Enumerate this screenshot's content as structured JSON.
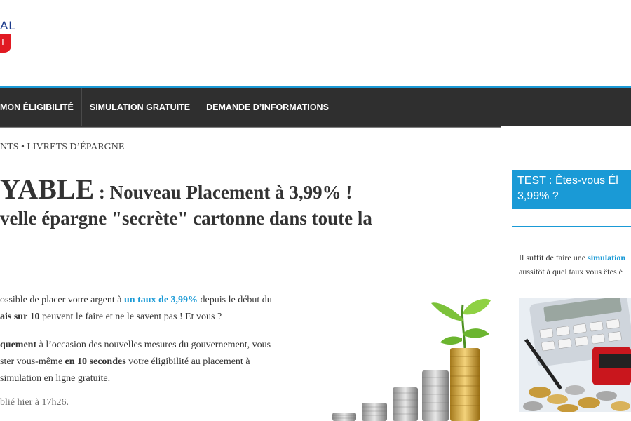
{
  "logo": {
    "text": "AL",
    "badge_text": "T"
  },
  "nav": {
    "items": [
      "MON ÉLIGIBILITÉ",
      "SIMULATION GRATUITE",
      "DEMANDE D’INFORMATIONS"
    ]
  },
  "breadcrumb": "NTS • LIVRETS D’ÉPARGNE",
  "article": {
    "headline_big": "YABLE",
    "headline_rest": " : Nouveau Placement à 3,99% !",
    "headline_line2": "velle épargne \"secrète\" cartonne dans toute la",
    "p1_a": "ossible de placer votre argent à ",
    "p1_link": "un taux de 3,99%",
    "p1_b": " depuis le début du",
    "p1_l2_bold": "ais sur 10",
    "p1_l2_rest": " peuvent le faire et ne le savent pas ! Et vous ?",
    "p2_bold": "quement",
    "p2_rest": " à l’occasion des nouvelles mesures du gouvernement, vous",
    "p2_l2_a": "ster vous-même ",
    "p2_l2_bold": "en 10 secondes",
    "p2_l2_b": " votre éligibilité au placement à",
    "p2_l3": "simulation en ligne gratuite.",
    "published": "blié hier à 17h26."
  },
  "sidebar": {
    "box_title": "TEST : Êtes-vous Él 3,99% ?",
    "text_a": "Il suffit de faire une ",
    "text_link": "simulation",
    "text_l2": "aussitôt à quel taux vous êtes é"
  },
  "colors": {
    "accent": "#1a9ad6",
    "nav_bg": "#2f2f2f",
    "logo_red": "#e11a22",
    "logo_blue": "#1c3b8c"
  }
}
